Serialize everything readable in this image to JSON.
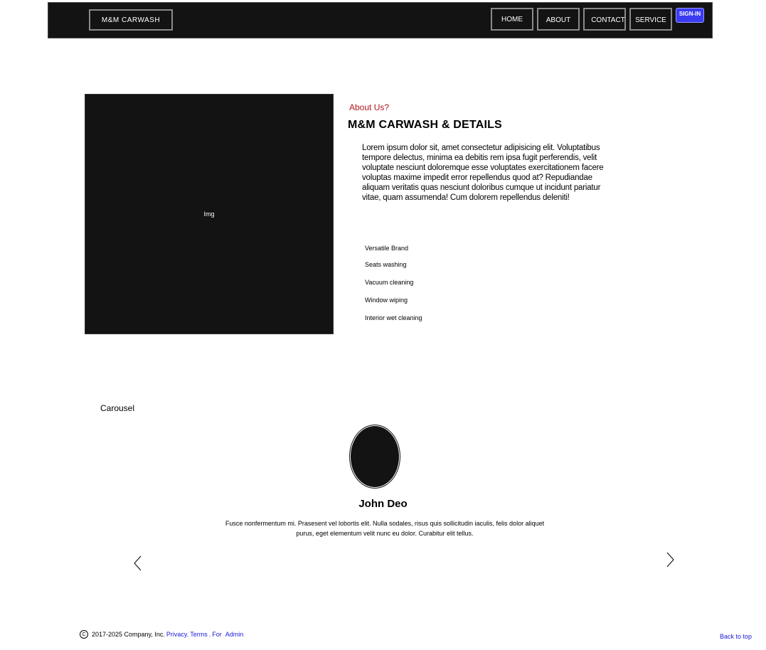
{
  "nav": {
    "brand": "M&M CARWASH",
    "links": [
      "HOME",
      "ABOUT",
      "CONTACT",
      "SERVICE"
    ],
    "signin": "SIGN-IN"
  },
  "about": {
    "image_label": "Img",
    "eyebrow": "About Us?",
    "title": "M&M CARWASH & DETAILS",
    "body": "Lorem ipsum dolor sit, amet consectetur adipisicing elit. Voluptatibus tempore delectus, minima ea debitis rem ipsa fugit perferendis, velit voluptate nesciunt doloremque esse voluptates exercitationem facere voluptas maxime impedit error repellendus quod at? Repudiandae aliquam veritatis quas nesciunt doloribus cumque ut incidunt pariatur vitae, quam assumenda! Cum dolorem repellendus deleniti!",
    "features": [
      "Versatile Brand",
      "Seats washing",
      "Vacuum cleaning",
      "Window wiping",
      "Interior wet cleaning"
    ]
  },
  "carousel": {
    "label": "Carousel",
    "name": "John Deo",
    "text": "Fusce nonfermentum mi. Prasesent vel lobortis elit. Nulla sodales, risus quis sollicitudin iaculis, felis dolor aliquet purus, eget elementum velit nunc eu dolor. Curabitur elit tellus."
  },
  "footer": {
    "copyright_symbol": "C",
    "copyright": "2017-2025 Company, Inc.",
    "privacy": "Privacy.",
    "terms": "Terms",
    "sep": ".",
    "for": "For",
    "admin": "Admin",
    "back_to_top": "Back to top"
  },
  "colors": {
    "nav_bg": "#131313",
    "signin_bg": "#3b3bf2",
    "eyebrow": "#b3141e",
    "link": "#1a1ad9"
  }
}
